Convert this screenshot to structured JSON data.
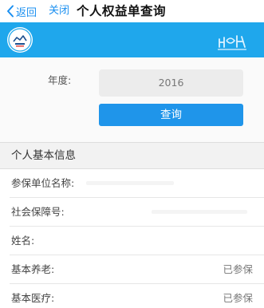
{
  "nav": {
    "back_label": "返回",
    "close_label": "关闭",
    "title": "个人权益单查询"
  },
  "form": {
    "year_label": "年度:",
    "year_value": "2016",
    "query_button": "查询"
  },
  "section": {
    "title": "个人基本信息"
  },
  "rows": [
    {
      "label": "参保单位名称:",
      "value": ""
    },
    {
      "label": "社会保障号:",
      "value": ""
    },
    {
      "label": "姓名:",
      "value": ""
    },
    {
      "label": "基本养老:",
      "value": "已参保"
    },
    {
      "label": "基本医疗:",
      "value": "已参保"
    }
  ],
  "colors": {
    "accent": "#1fa7ec",
    "button": "#1f95ea",
    "link": "#1a8ff0"
  },
  "icons": {
    "back": "chevron-left-icon",
    "logo": "logo-icon",
    "brand": "brand-mark-icon"
  }
}
